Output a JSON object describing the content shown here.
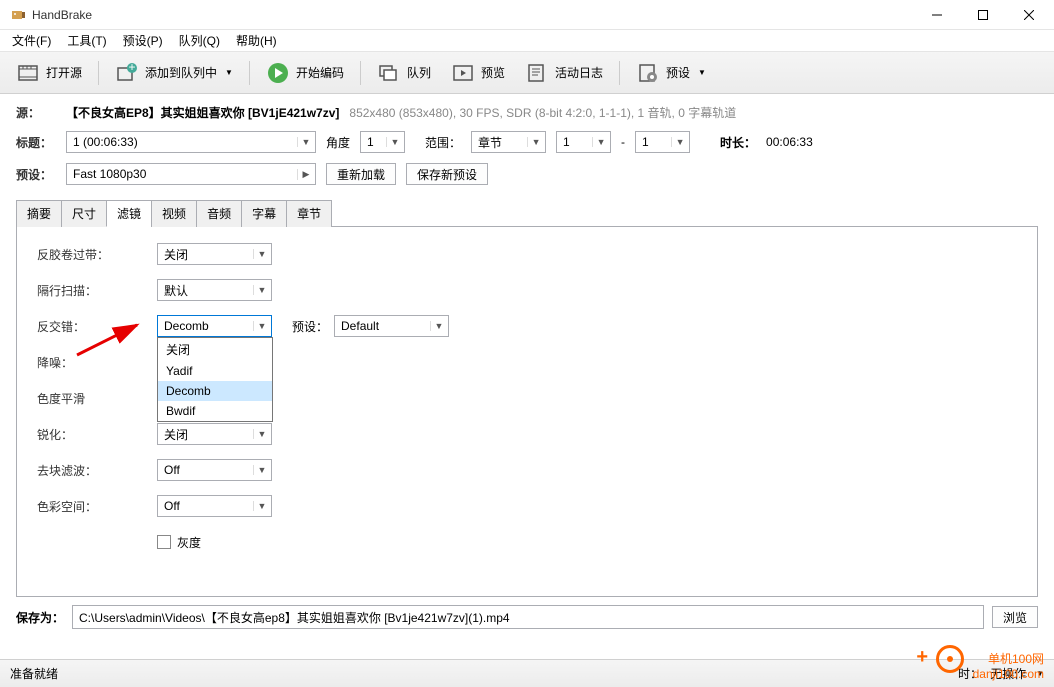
{
  "window": {
    "title": "HandBrake"
  },
  "menu": [
    "文件(F)",
    "工具(T)",
    "预设(P)",
    "队列(Q)",
    "帮助(H)"
  ],
  "toolbar": {
    "open": "打开源",
    "addQueue": "添加到队列中",
    "start": "开始编码",
    "queue": "队列",
    "preview": "预览",
    "log": "活动日志",
    "presets": "预设"
  },
  "source": {
    "label": "源：",
    "name": "【不良女高EP8】其实姐姐喜欢你 [BV1jE421w7zv]",
    "info": "852x480 (853x480), 30 FPS, SDR (8-bit 4:2:0, 1-1-1), 1 音轨, 0 字幕轨道"
  },
  "title_row": {
    "label": "标题：",
    "value": "1 (00:06:33)",
    "angle_label": "角度",
    "angle_value": "1",
    "range_label": "范围：",
    "range_type": "章节",
    "range_from": "1",
    "range_to": "1",
    "duration_label": "时长：",
    "duration_value": "00:06:33"
  },
  "preset_row": {
    "label": "预设：",
    "value": "Fast 1080p30",
    "reload": "重新加载",
    "save": "保存新预设"
  },
  "tabs": [
    "摘要",
    "尺寸",
    "滤镜",
    "视频",
    "音频",
    "字幕",
    "章节"
  ],
  "filters": {
    "detelecine": {
      "label": "反胶卷过带：",
      "value": "关闭"
    },
    "interlace": {
      "label": "隔行扫描：",
      "value": "默认"
    },
    "deinterlace": {
      "label": "反交错：",
      "value": "Decomb",
      "preset_label": "预设：",
      "preset_value": "Default"
    },
    "deinterlace_options": [
      "关闭",
      "Yadif",
      "Decomb",
      "Bwdif"
    ],
    "denoise": {
      "label": "降噪："
    },
    "chroma": {
      "label": "色度平滑"
    },
    "sharpen": {
      "label": "锐化：",
      "value": "关闭"
    },
    "deblock": {
      "label": "去块滤波：",
      "value": "Off"
    },
    "colorspace": {
      "label": "色彩空间：",
      "value": "Off"
    },
    "grayscale": "灰度"
  },
  "save": {
    "label": "保存为：",
    "path": "C:\\Users\\admin\\Videos\\【不良女高ep8】其实姐姐喜欢你 [Bv1je421w7zv](1).mp4",
    "browse": "浏览"
  },
  "status": {
    "ready": "准备就绪",
    "done_label": "时：",
    "done_value": "无操作"
  },
  "watermark": {
    "line1": "单机100网",
    "line2": "danji100.com"
  }
}
